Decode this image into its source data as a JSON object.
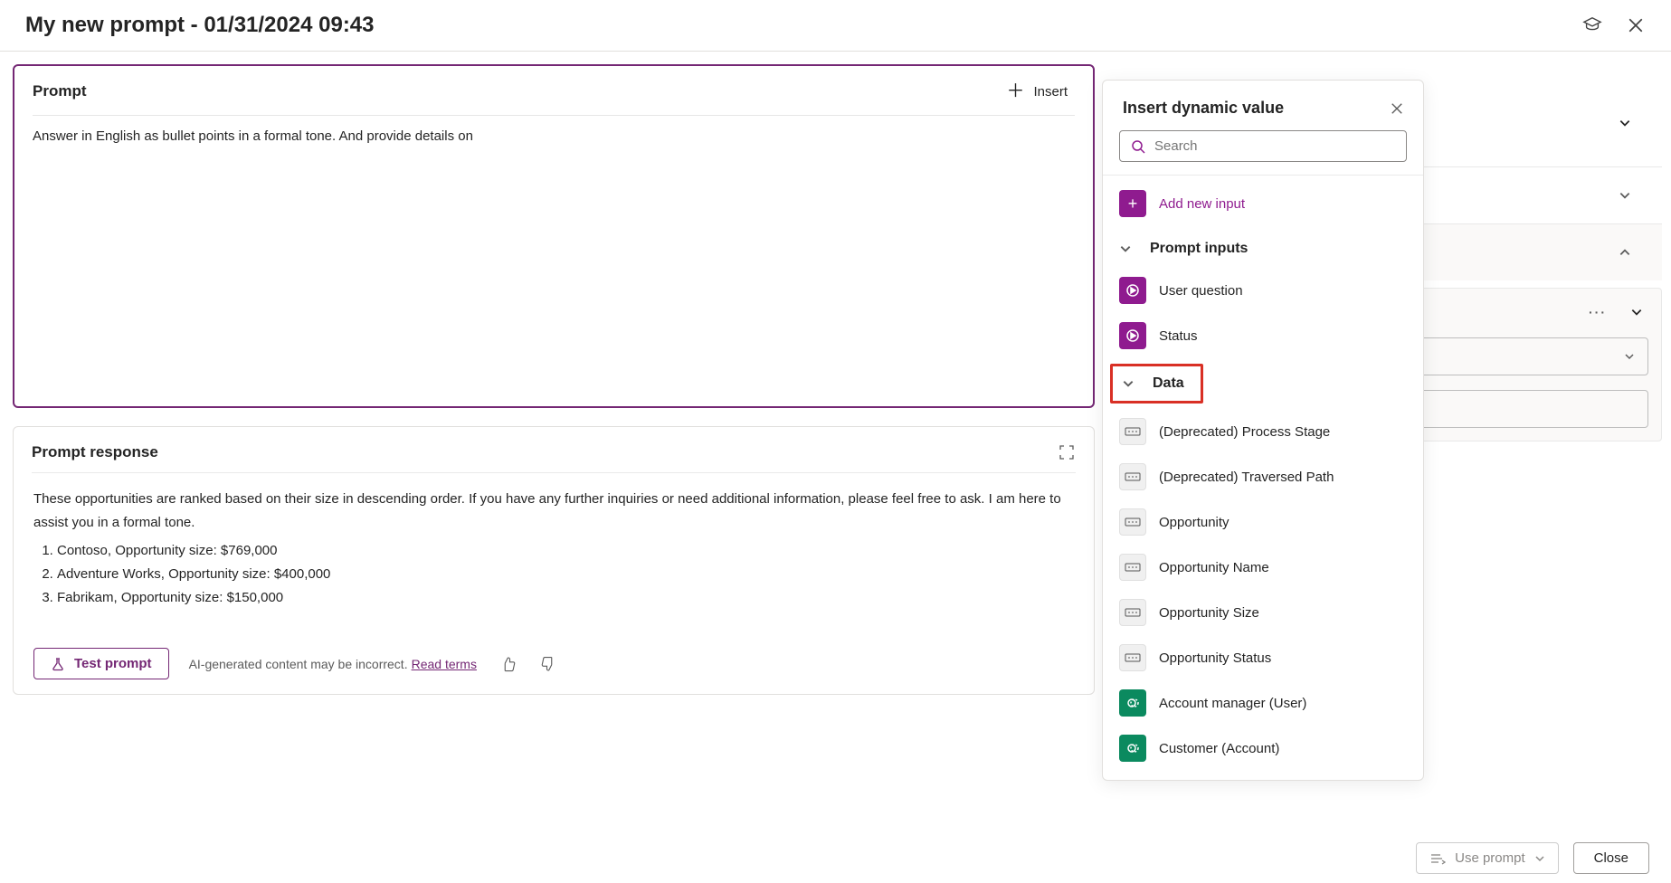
{
  "header": {
    "title": "My new prompt - 01/31/2024 09:43"
  },
  "prompt": {
    "section_label": "Prompt",
    "insert_label": "Insert",
    "text": "Answer in English as bullet points in a formal tone. And provide details on"
  },
  "response": {
    "section_label": "Prompt response",
    "intro": "These opportunities are ranked based on their size in descending order. If you have any further inquiries or need additional information, please feel free to ask. I am here to assist you in a formal tone.",
    "items": [
      "Contoso, Opportunity size: $769,000",
      "Adventure Works, Opportunity size: $400,000",
      "Fabrikam, Opportunity size: $150,000"
    ],
    "test_label": "Test prompt",
    "disclaimer": "AI-generated content may be incorrect.",
    "read_terms": "Read terms"
  },
  "panel": {
    "title": "Insert dynamic value",
    "search_placeholder": "Search",
    "add_input": "Add new input",
    "section_prompt_inputs": "Prompt inputs",
    "prompt_inputs": [
      "User question",
      "Status"
    ],
    "section_data": "Data",
    "data_items": [
      {
        "label": "(Deprecated) Process Stage",
        "type": "text"
      },
      {
        "label": "(Deprecated) Traversed Path",
        "type": "text"
      },
      {
        "label": "Opportunity",
        "type": "text"
      },
      {
        "label": "Opportunity Name",
        "type": "text"
      },
      {
        "label": "Opportunity Size",
        "type": "text"
      },
      {
        "label": "Opportunity Status",
        "type": "text"
      },
      {
        "label": "Account manager (User)",
        "type": "lookup"
      },
      {
        "label": "Customer (Account)",
        "type": "lookup"
      }
    ]
  },
  "footer": {
    "use_prompt": "Use prompt",
    "close": "Close"
  }
}
